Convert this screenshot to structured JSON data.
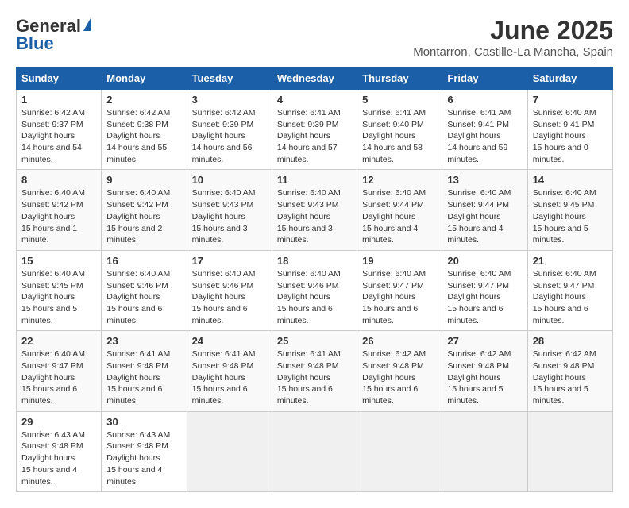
{
  "header": {
    "logo_general": "General",
    "logo_blue": "Blue",
    "title": "June 2025",
    "location": "Montarron, Castille-La Mancha, Spain"
  },
  "days_of_week": [
    "Sunday",
    "Monday",
    "Tuesday",
    "Wednesday",
    "Thursday",
    "Friday",
    "Saturday"
  ],
  "weeks": [
    [
      {
        "day": "1",
        "sunrise": "6:42 AM",
        "sunset": "9:37 PM",
        "daylight": "14 hours and 54 minutes."
      },
      {
        "day": "2",
        "sunrise": "6:42 AM",
        "sunset": "9:38 PM",
        "daylight": "14 hours and 55 minutes."
      },
      {
        "day": "3",
        "sunrise": "6:42 AM",
        "sunset": "9:39 PM",
        "daylight": "14 hours and 56 minutes."
      },
      {
        "day": "4",
        "sunrise": "6:41 AM",
        "sunset": "9:39 PM",
        "daylight": "14 hours and 57 minutes."
      },
      {
        "day": "5",
        "sunrise": "6:41 AM",
        "sunset": "9:40 PM",
        "daylight": "14 hours and 58 minutes."
      },
      {
        "day": "6",
        "sunrise": "6:41 AM",
        "sunset": "9:41 PM",
        "daylight": "14 hours and 59 minutes."
      },
      {
        "day": "7",
        "sunrise": "6:40 AM",
        "sunset": "9:41 PM",
        "daylight": "15 hours and 0 minutes."
      }
    ],
    [
      {
        "day": "8",
        "sunrise": "6:40 AM",
        "sunset": "9:42 PM",
        "daylight": "15 hours and 1 minute."
      },
      {
        "day": "9",
        "sunrise": "6:40 AM",
        "sunset": "9:42 PM",
        "daylight": "15 hours and 2 minutes."
      },
      {
        "day": "10",
        "sunrise": "6:40 AM",
        "sunset": "9:43 PM",
        "daylight": "15 hours and 3 minutes."
      },
      {
        "day": "11",
        "sunrise": "6:40 AM",
        "sunset": "9:43 PM",
        "daylight": "15 hours and 3 minutes."
      },
      {
        "day": "12",
        "sunrise": "6:40 AM",
        "sunset": "9:44 PM",
        "daylight": "15 hours and 4 minutes."
      },
      {
        "day": "13",
        "sunrise": "6:40 AM",
        "sunset": "9:44 PM",
        "daylight": "15 hours and 4 minutes."
      },
      {
        "day": "14",
        "sunrise": "6:40 AM",
        "sunset": "9:45 PM",
        "daylight": "15 hours and 5 minutes."
      }
    ],
    [
      {
        "day": "15",
        "sunrise": "6:40 AM",
        "sunset": "9:45 PM",
        "daylight": "15 hours and 5 minutes."
      },
      {
        "day": "16",
        "sunrise": "6:40 AM",
        "sunset": "9:46 PM",
        "daylight": "15 hours and 6 minutes."
      },
      {
        "day": "17",
        "sunrise": "6:40 AM",
        "sunset": "9:46 PM",
        "daylight": "15 hours and 6 minutes."
      },
      {
        "day": "18",
        "sunrise": "6:40 AM",
        "sunset": "9:46 PM",
        "daylight": "15 hours and 6 minutes."
      },
      {
        "day": "19",
        "sunrise": "6:40 AM",
        "sunset": "9:47 PM",
        "daylight": "15 hours and 6 minutes."
      },
      {
        "day": "20",
        "sunrise": "6:40 AM",
        "sunset": "9:47 PM",
        "daylight": "15 hours and 6 minutes."
      },
      {
        "day": "21",
        "sunrise": "6:40 AM",
        "sunset": "9:47 PM",
        "daylight": "15 hours and 6 minutes."
      }
    ],
    [
      {
        "day": "22",
        "sunrise": "6:40 AM",
        "sunset": "9:47 PM",
        "daylight": "15 hours and 6 minutes."
      },
      {
        "day": "23",
        "sunrise": "6:41 AM",
        "sunset": "9:48 PM",
        "daylight": "15 hours and 6 minutes."
      },
      {
        "day": "24",
        "sunrise": "6:41 AM",
        "sunset": "9:48 PM",
        "daylight": "15 hours and 6 minutes."
      },
      {
        "day": "25",
        "sunrise": "6:41 AM",
        "sunset": "9:48 PM",
        "daylight": "15 hours and 6 minutes."
      },
      {
        "day": "26",
        "sunrise": "6:42 AM",
        "sunset": "9:48 PM",
        "daylight": "15 hours and 6 minutes."
      },
      {
        "day": "27",
        "sunrise": "6:42 AM",
        "sunset": "9:48 PM",
        "daylight": "15 hours and 5 minutes."
      },
      {
        "day": "28",
        "sunrise": "6:42 AM",
        "sunset": "9:48 PM",
        "daylight": "15 hours and 5 minutes."
      }
    ],
    [
      {
        "day": "29",
        "sunrise": "6:43 AM",
        "sunset": "9:48 PM",
        "daylight": "15 hours and 4 minutes."
      },
      {
        "day": "30",
        "sunrise": "6:43 AM",
        "sunset": "9:48 PM",
        "daylight": "15 hours and 4 minutes."
      },
      null,
      null,
      null,
      null,
      null
    ]
  ],
  "labels": {
    "sunrise": "Sunrise:",
    "sunset": "Sunset:",
    "daylight": "Daylight hours"
  }
}
